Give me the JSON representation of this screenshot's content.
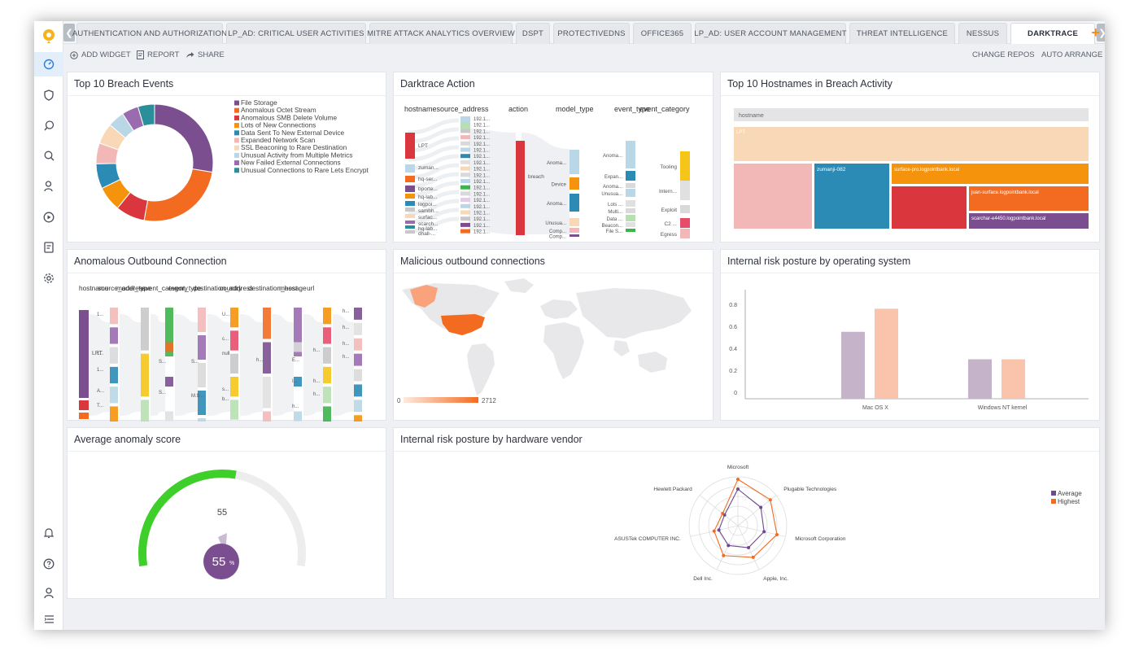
{
  "tabs": [
    "AUTHENTICATION AND AUTHORIZATION",
    "LP_AD: CRITICAL USER ACTIVITIES",
    "MITRE ATTACK ANALYTICS OVERVIEW",
    "DSPT",
    "PROTECTIVEDNS",
    "OFFICE365",
    "LP_AD: USER ACCOUNT MANAGEMENT",
    "THREAT INTELLIGENCE",
    "NESSUS",
    "DARKTRACE"
  ],
  "toolbar": {
    "add_widget": "ADD WIDGET",
    "report": "REPORT",
    "share": "SHARE",
    "change_repos": "CHANGE REPOS",
    "auto_arrange": "AUTO ARRANGE"
  },
  "widgets": {
    "breach_events": "Top 10 Breach Events",
    "darktrace_action": "Darktrace Action",
    "top_hostnames": "Top 10 Hostnames in Breach Activity",
    "anomalous_outbound": "Anomalous Outbound Connection",
    "malicious_outbound": "Malicious outbound connections",
    "risk_os": "Internal risk posture by operating system",
    "avg_anomaly": "Average anomaly score",
    "risk_hw": "Internal risk posture by hardware vendor"
  },
  "donut": {
    "legend": [
      {
        "label": "File Storage",
        "color": "#7b4f8f"
      },
      {
        "label": "Anomalous Octet Stream",
        "color": "#f26b21"
      },
      {
        "label": "Anomalous SMB Delete Volume",
        "color": "#d9373d"
      },
      {
        "label": "Lots of New Connections",
        "color": "#f5930c"
      },
      {
        "label": "Data Sent To New External Device",
        "color": "#2b8bb5"
      },
      {
        "label": "Expanded Network Scan",
        "color": "#f2b8b8"
      },
      {
        "label": "SSL Beaconing to Rare Destination",
        "color": "#f9d8b7"
      },
      {
        "label": "Unusual Activity from Multiple Metrics",
        "color": "#b9d7e6"
      },
      {
        "label": "New Failed External Connections",
        "color": "#9b6bb0"
      },
      {
        "label": "Unusual Connections to Rare Lets Encrypt",
        "color": "#2b8e9b"
      }
    ],
    "values": [
      24,
      22,
      7,
      6,
      6,
      5,
      5,
      4,
      4,
      4
    ]
  },
  "sankey1": {
    "headers": [
      "hostname",
      "source_address",
      "action",
      "model_type",
      "event_type",
      "event_category"
    ],
    "hosts": [
      "LPT",
      "zuman...",
      "hq-ser...",
      "bporte...",
      "hq-lab...",
      "logpoi...",
      "sambh...",
      "surfac...",
      "scarch...",
      "hq-lab...",
      "dhall-..."
    ],
    "ips": [
      "192.1...",
      "192.1...",
      "192.1...",
      "192.1...",
      "192.1...",
      "192.1...",
      "192.1...",
      "192.1...",
      "192.1...",
      "192.1...",
      "192.1...",
      "192.1...",
      "192.1...",
      "192.1...",
      "192.1...",
      "192.1...",
      "192.1...",
      "192.1...",
      "192.1..."
    ],
    "action": "breach",
    "model_types": [
      "Anoma...",
      "Device",
      "Anoma...",
      "Unusua...",
      "Comp...",
      "Comp..."
    ],
    "event_types": [
      "Anoma...",
      "Expan...",
      "Anoma...",
      "Unusua...",
      "Lots ...",
      "Multi...",
      "Data ...",
      "Beacon...",
      "File S..."
    ],
    "categories": [
      "Tooling",
      "Intern...",
      "Exploit",
      "C2 ...",
      "Egress"
    ]
  },
  "sankey2": {
    "headers": [
      "hostname",
      "source_address",
      "model_type",
      "event_category",
      "event_type",
      "destination_address",
      "country",
      "destination_host",
      "message",
      "url"
    ],
    "cells": [
      "1...",
      "1...",
      "1...",
      "A...",
      "T...",
      "S...",
      "S...",
      "S...",
      "M.9...",
      "U...",
      "c...",
      "null",
      "s...",
      "b...",
      "h...",
      "E...",
      "I...",
      "h...",
      "h...",
      "h...",
      "h...",
      "h...",
      "h...",
      "h...",
      "h..."
    ],
    "host": "LPT"
  },
  "map": {
    "legend_min": "0",
    "legend_max": "2712"
  },
  "bar_os": {
    "chart_data": {
      "type": "bar",
      "categories": [
        "Mac OS X",
        "Windows NT kernel"
      ],
      "series": [
        {
          "values": [
            0.55,
            0.3
          ],
          "color": "#c5b4c9"
        },
        {
          "values": [
            0.76,
            0.3
          ],
          "color": "#f9c3ac"
        }
      ],
      "yticks": [
        "0",
        "0.2",
        "0.4",
        "0.6",
        "0.8"
      ],
      "ylim": [
        0,
        0.8
      ]
    }
  },
  "gauge": {
    "value": 55,
    "label": "55",
    "badge": "55",
    "pct": "%"
  },
  "radar": {
    "chart_data": {
      "type": "radar",
      "axes": [
        "Microsoft",
        "Plugable Technologies",
        "Microsoft Corporation",
        "Apple, Inc.",
        "Dell Inc.",
        "ASUSTek COMPUTER INC.",
        "Hewlett Packard"
      ],
      "series": [
        {
          "name": "Average",
          "color": "#6b4a8e",
          "values": [
            0.75,
            0.6,
            0.55,
            0.5,
            0.45,
            0.4,
            0.35
          ]
        },
        {
          "name": "Highest",
          "color": "#f26b21",
          "values": [
            0.95,
            0.85,
            0.82,
            0.72,
            0.68,
            0.5,
            0.4
          ]
        }
      ]
    }
  }
}
